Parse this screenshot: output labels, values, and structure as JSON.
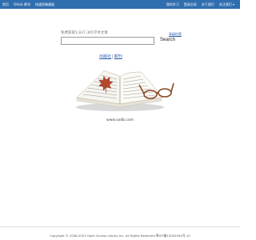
{
  "topbar": {
    "left_items": [
      "首页",
      "OALib 期刊",
      "快速投稿通道"
    ],
    "right_items": [
      "我的学习",
      "登录后续",
      "关于我们",
      "关注我们 ▾"
    ]
  },
  "search": {
    "hint": "免费获取1,837,365学术文章",
    "advanced_link": "高级检索",
    "placeholder": "",
    "button_label": "Search"
  },
  "publish_links": {
    "left": "出版社",
    "separator": "|",
    "right": "期刊"
  },
  "site_url": "www.oalib.com",
  "footer": {
    "copyright": "Copyright © 2006-2023 Open Access Library Inc. All Rights Reserved.粤ICP备13002944号-10"
  },
  "colors": {
    "topbar": "#2f6eaf",
    "link": "#2a5db0",
    "leaf": "#b4472c"
  },
  "icons": [
    "book-illustration",
    "maple-leaf",
    "eyeglasses"
  ]
}
